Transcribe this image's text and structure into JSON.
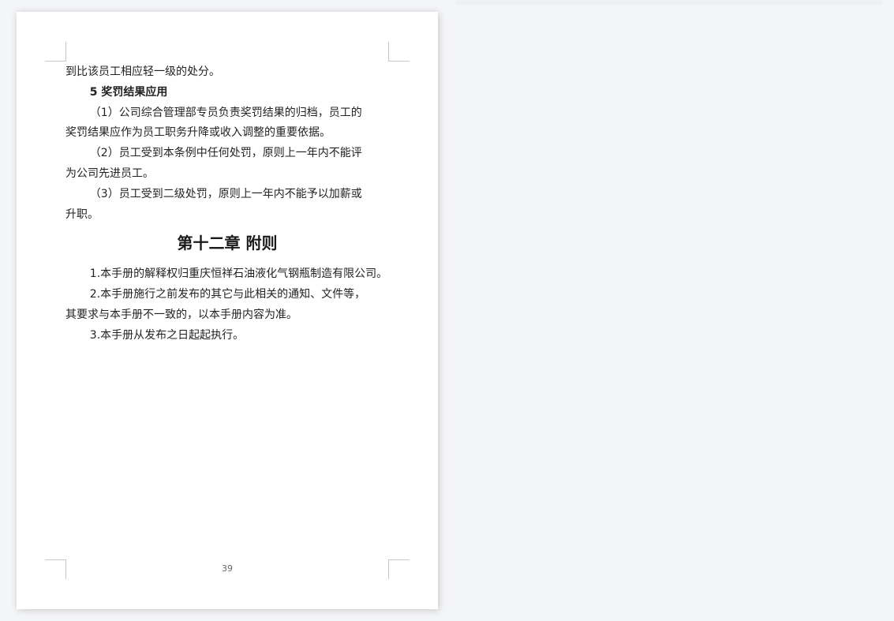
{
  "document": {
    "lines": {
      "l1": "到比该员工相应轻一级的处分。",
      "l2": "5  奖罚结果应用",
      "l3": "（1）公司综合管理部专员负责奖罚结果的归档，员工的",
      "l4": "奖罚结果应作为员工职务升降或收入调整的重要依据。",
      "l5": "（2）员工受到本条例中任何处罚，原则上一年内不能评",
      "l6": "为公司先进员工。",
      "l7": "（3）员工受到二级处罚，原则上一年内不能予以加薪或",
      "l8": "升职。",
      "chapter": "第十二章 附则",
      "l9": "1.本手册的解释权归重庆恒祥石油液化气钢瓶制造有限公司。",
      "l10": "2.本手册施行之前发布的其它与此相关的通知、文件等，",
      "l11": "其要求与本手册不一致的，以本手册内容为准。",
      "l12": "3.本手册从发布之日起起执行。"
    },
    "page_number": "39"
  }
}
